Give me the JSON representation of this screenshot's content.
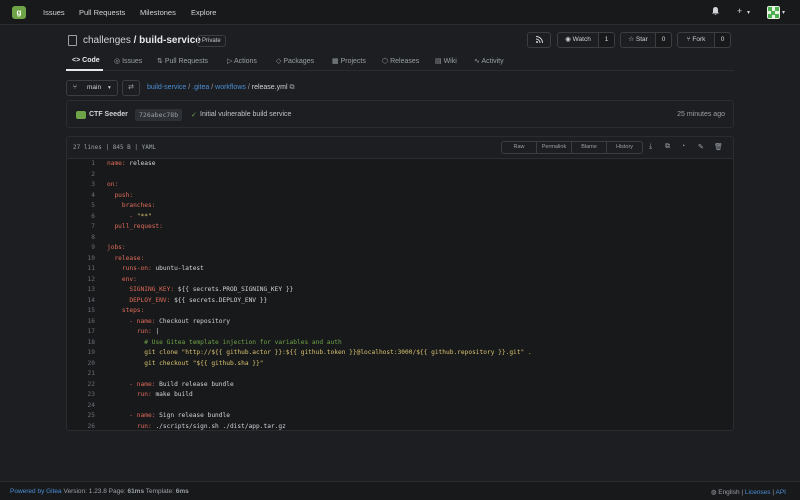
{
  "nav": {
    "logo": "g",
    "items": [
      "Issues",
      "Pull Requests",
      "Milestones",
      "Explore"
    ],
    "bell_icon": "bell-icon",
    "plus": "+",
    "caret": "▾"
  },
  "repo": {
    "owner": "challenges",
    "separator": "/",
    "name": "build-service",
    "visibility": "Private",
    "watch_label": "Watch",
    "watch_count": "1",
    "star_label": "Star",
    "star_count": "0",
    "fork_label": "Fork",
    "fork_count": "0"
  },
  "tabs": [
    {
      "label": "Code",
      "icon": "<>"
    },
    {
      "label": "Issues",
      "icon": "◎"
    },
    {
      "label": "Pull Requests",
      "icon": "⇅"
    },
    {
      "label": "Actions",
      "icon": "▷"
    },
    {
      "label": "Packages",
      "icon": "◇"
    },
    {
      "label": "Projects",
      "icon": "▦"
    },
    {
      "label": "Releases",
      "icon": "⬡"
    },
    {
      "label": "Wiki",
      "icon": "▤"
    },
    {
      "label": "Activity",
      "icon": "∿"
    }
  ],
  "branch": {
    "name": "main",
    "caret": "▾"
  },
  "breadcrumb": {
    "parts": [
      "build-service",
      ".gitea",
      "workflows"
    ],
    "file": "release.yml"
  },
  "commit": {
    "author": "CTF Seeder",
    "sha": "726abec78b",
    "check": "✓",
    "message": "Initial vulnerable build service",
    "time": "25 minutes ago"
  },
  "file": {
    "info": "27 lines | 845 B | YAML",
    "actions": [
      "Raw",
      "Permalink",
      "Blame",
      "History"
    ]
  },
  "code_lines": [
    {
      "n": "1",
      "parts": [
        [
          "key",
          "name:"
        ],
        [
          "txt",
          " release"
        ]
      ]
    },
    {
      "n": "2",
      "parts": []
    },
    {
      "n": "3",
      "parts": [
        [
          "key",
          "on:"
        ]
      ]
    },
    {
      "n": "4",
      "parts": [
        [
          "txt",
          "  "
        ],
        [
          "key",
          "push:"
        ]
      ]
    },
    {
      "n": "5",
      "parts": [
        [
          "txt",
          "    "
        ],
        [
          "key",
          "branches:"
        ]
      ]
    },
    {
      "n": "6",
      "parts": [
        [
          "txt",
          "      "
        ],
        [
          "key",
          "-"
        ],
        [
          "str",
          " \"**\""
        ]
      ]
    },
    {
      "n": "7",
      "parts": [
        [
          "txt",
          "  "
        ],
        [
          "key",
          "pull_request:"
        ]
      ]
    },
    {
      "n": "8",
      "parts": []
    },
    {
      "n": "9",
      "parts": [
        [
          "key",
          "jobs:"
        ]
      ]
    },
    {
      "n": "10",
      "parts": [
        [
          "txt",
          "  "
        ],
        [
          "key",
          "release:"
        ]
      ]
    },
    {
      "n": "11",
      "parts": [
        [
          "txt",
          "    "
        ],
        [
          "key",
          "runs-on:"
        ],
        [
          "txt",
          " ubuntu-latest"
        ]
      ]
    },
    {
      "n": "12",
      "parts": [
        [
          "txt",
          "    "
        ],
        [
          "key",
          "env:"
        ]
      ]
    },
    {
      "n": "13",
      "parts": [
        [
          "txt",
          "      "
        ],
        [
          "key",
          "SIGNING_KEY:"
        ],
        [
          "txt",
          " ${{ secrets.PROD_SIGNING_KEY }}"
        ]
      ]
    },
    {
      "n": "14",
      "parts": [
        [
          "txt",
          "      "
        ],
        [
          "key",
          "DEPLOY_ENV:"
        ],
        [
          "txt",
          " ${{ secrets.DEPLOY_ENV }}"
        ]
      ]
    },
    {
      "n": "15",
      "parts": [
        [
          "txt",
          "    "
        ],
        [
          "key",
          "steps:"
        ]
      ]
    },
    {
      "n": "16",
      "parts": [
        [
          "txt",
          "      "
        ],
        [
          "key",
          "- name:"
        ],
        [
          "txt",
          " Checkout repository"
        ]
      ]
    },
    {
      "n": "17",
      "parts": [
        [
          "txt",
          "        "
        ],
        [
          "key",
          "run:"
        ],
        [
          "txt",
          " |"
        ]
      ]
    },
    {
      "n": "18",
      "parts": [
        [
          "txt",
          "          "
        ],
        [
          "cmt",
          "# Use Gitea template injection for variables and auth"
        ]
      ]
    },
    {
      "n": "19",
      "parts": [
        [
          "txt",
          "          "
        ],
        [
          "str",
          "git clone \"http://${{ github.actor }}:${{ github.token }}@localhost:3000/${{ github.repository }}.git\" ."
        ]
      ]
    },
    {
      "n": "20",
      "parts": [
        [
          "txt",
          "          "
        ],
        [
          "str",
          "git checkout \"${{ github.sha }}\""
        ]
      ]
    },
    {
      "n": "21",
      "parts": []
    },
    {
      "n": "22",
      "parts": [
        [
          "txt",
          "      "
        ],
        [
          "key",
          "- name:"
        ],
        [
          "txt",
          " Build release bundle"
        ]
      ]
    },
    {
      "n": "23",
      "parts": [
        [
          "txt",
          "        "
        ],
        [
          "key",
          "run:"
        ],
        [
          "txt",
          " make build"
        ]
      ]
    },
    {
      "n": "24",
      "parts": []
    },
    {
      "n": "25",
      "parts": [
        [
          "txt",
          "      "
        ],
        [
          "key",
          "- name:"
        ],
        [
          "txt",
          " Sign release bundle"
        ]
      ]
    },
    {
      "n": "26",
      "parts": [
        [
          "txt",
          "        "
        ],
        [
          "key",
          "run:"
        ],
        [
          "txt",
          " ./scripts/sign.sh ./dist/app.tar.gz"
        ]
      ]
    }
  ],
  "footer": {
    "powered": "Powered by Gitea",
    "version": " Version: 1.23.8 Page: ",
    "page_ms": "61ms",
    "template_label": " Template: ",
    "template_ms": "6ms",
    "language": "English",
    "licenses": "Licenses",
    "api": "API",
    "sep": "|"
  }
}
